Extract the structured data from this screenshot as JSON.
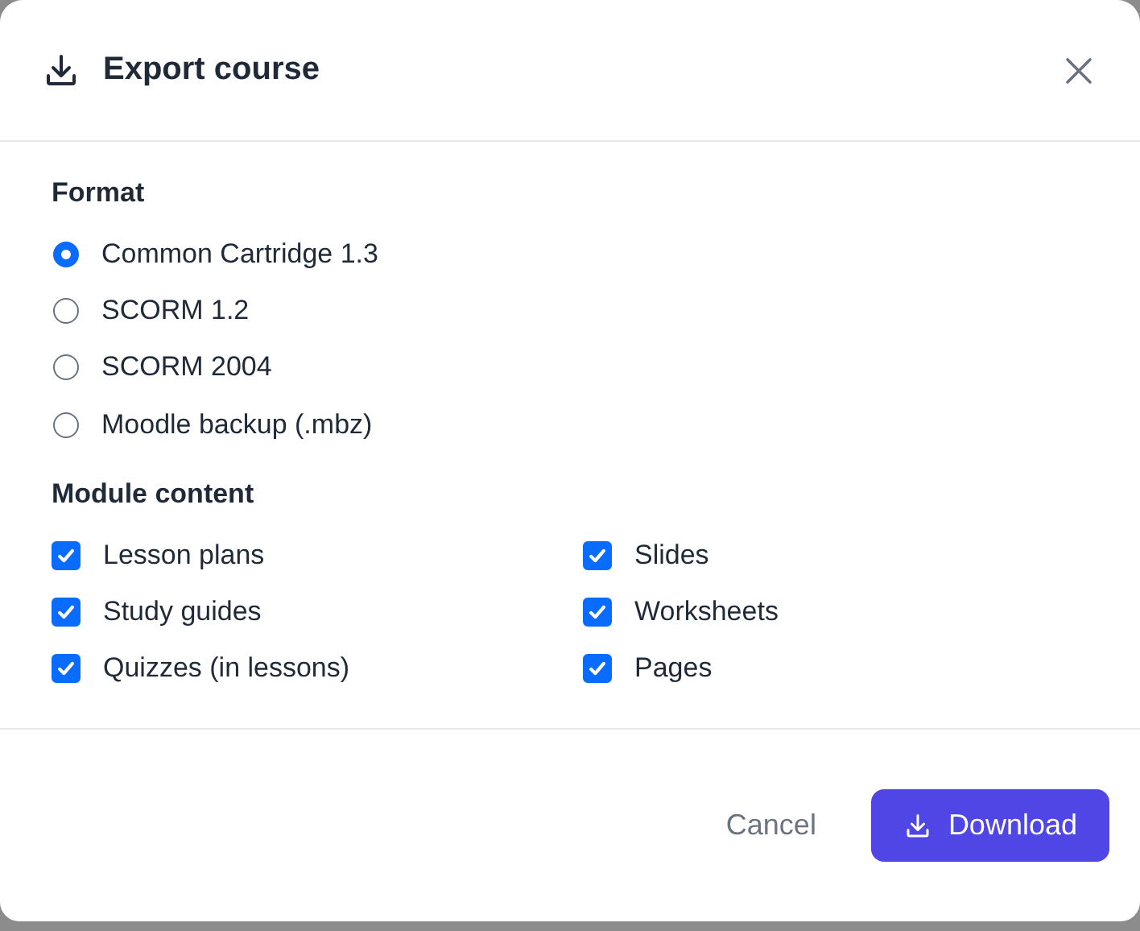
{
  "dialog": {
    "title": "Export course"
  },
  "format": {
    "label": "Format",
    "options": [
      {
        "label": "Common Cartridge 1.3",
        "selected": true
      },
      {
        "label": "SCORM 1.2",
        "selected": false
      },
      {
        "label": "SCORM 2004",
        "selected": false
      },
      {
        "label": "Moodle backup (.mbz)",
        "selected": false
      }
    ]
  },
  "module_content": {
    "label": "Module content",
    "items": [
      {
        "label": "Lesson plans",
        "checked": true
      },
      {
        "label": "Slides",
        "checked": true
      },
      {
        "label": "Study guides",
        "checked": true
      },
      {
        "label": "Worksheets",
        "checked": true
      },
      {
        "label": "Quizzes (in lessons)",
        "checked": true
      },
      {
        "label": "Pages",
        "checked": true
      }
    ]
  },
  "buttons": [
    {
      "label": "Cancel",
      "kind": "secondary"
    },
    {
      "label": "Download",
      "kind": "primary"
    }
  ]
}
